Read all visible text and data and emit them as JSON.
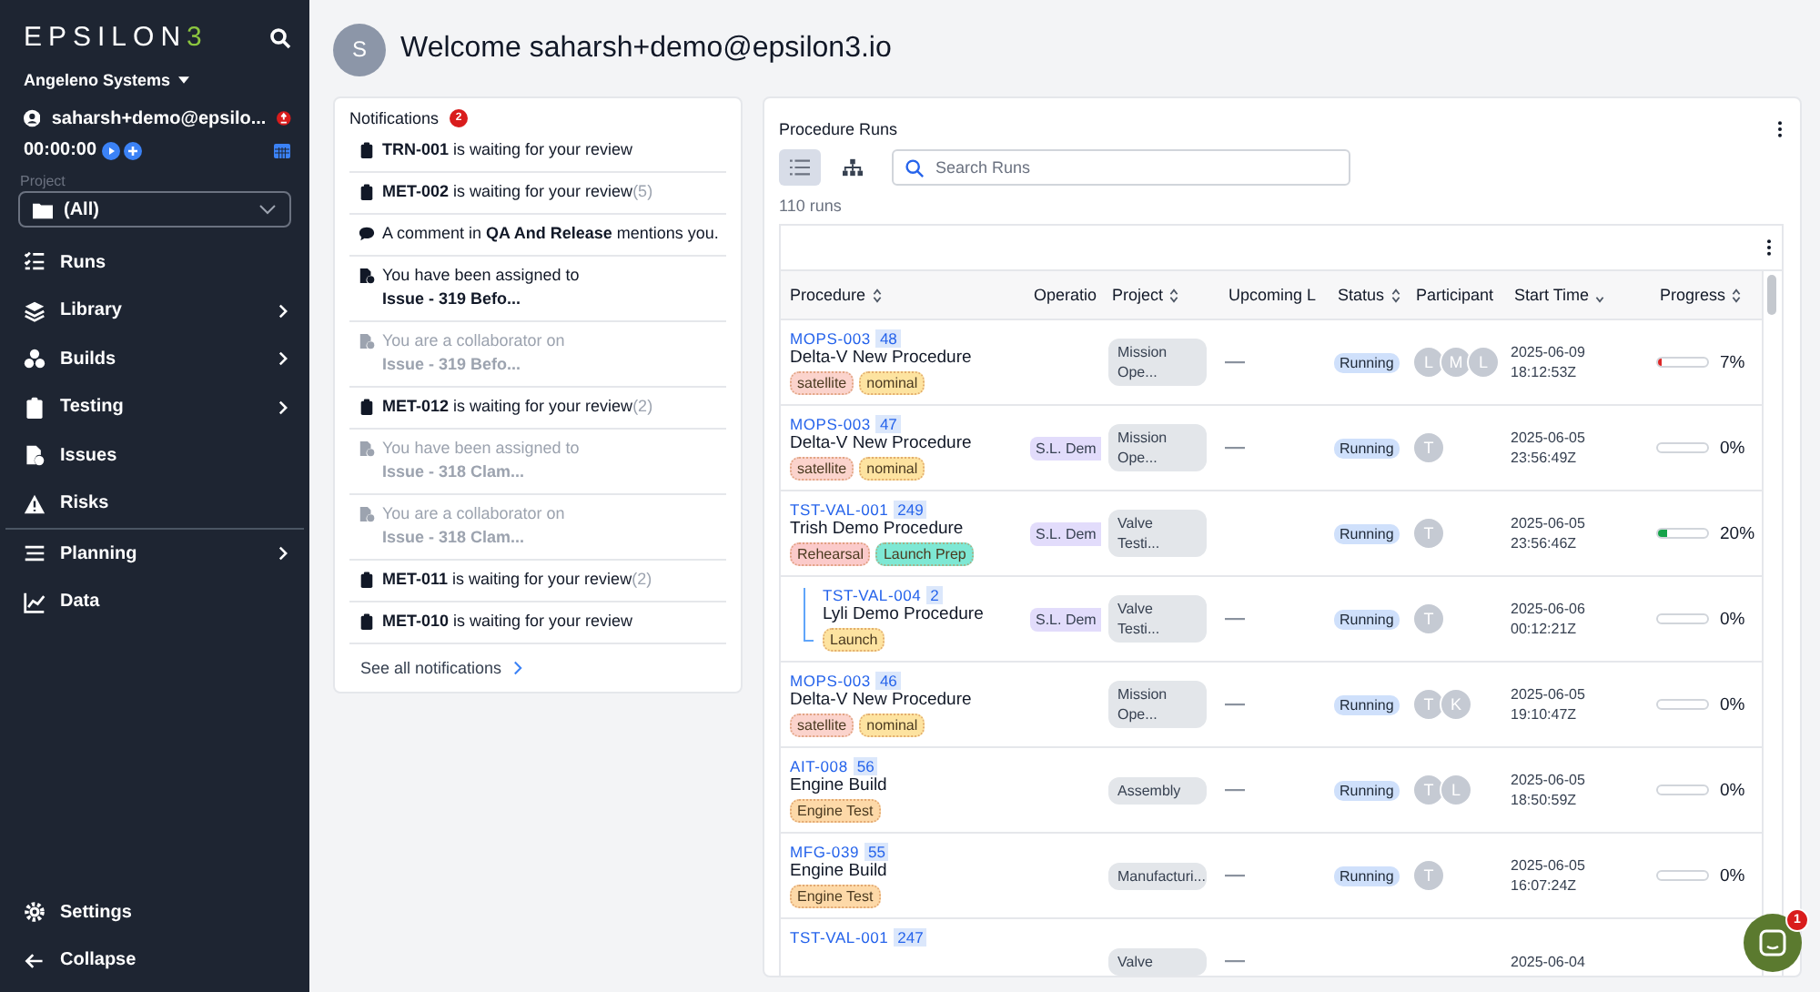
{
  "sidebar": {
    "logo": {
      "text": "EPSILON",
      "mark": "3"
    },
    "org": "Angeleno Systems",
    "user": "saharsh+demo@epsilo...",
    "timer": "00:00:00",
    "project": {
      "label": "Project",
      "value": "(All)"
    },
    "items": [
      {
        "label": "Runs",
        "expandable": false
      },
      {
        "label": "Library",
        "expandable": true
      },
      {
        "label": "Builds",
        "expandable": true
      },
      {
        "label": "Testing",
        "expandable": true
      },
      {
        "label": "Issues",
        "expandable": false
      },
      {
        "label": "Risks",
        "expandable": false
      }
    ],
    "items2": [
      {
        "label": "Planning",
        "expandable": true
      },
      {
        "label": "Data",
        "expandable": false
      }
    ],
    "footer": [
      "Settings",
      "Collapse"
    ]
  },
  "header": {
    "avatar": "S",
    "title": "Welcome saharsh+demo@epsilon3.io"
  },
  "notifications": {
    "title": "Notifications",
    "badge": "2",
    "link": "See all notifications",
    "items": [
      {
        "kind": "review",
        "read": false,
        "text": "**TRN-001** is waiting for your review"
      },
      {
        "kind": "review",
        "read": false,
        "text": "**MET-002** is waiting for your review",
        "count": "(5)"
      },
      {
        "kind": "comment",
        "read": false,
        "text": "A comment in **QA And Release** mentions you."
      },
      {
        "kind": "issue",
        "read": false,
        "text": "You have been assigned to",
        "subject": "Issue - 319 Befo..."
      },
      {
        "kind": "issue",
        "read": true,
        "text": "You are a collaborator on",
        "subject": "Issue - 319 Befo..."
      },
      {
        "kind": "review",
        "read": false,
        "text": "**MET-012** is waiting for your review",
        "count": "(2)"
      },
      {
        "kind": "issue",
        "read": true,
        "text": "You have been assigned to",
        "subject": "Issue - 318 Clam..."
      },
      {
        "kind": "issue",
        "read": true,
        "text": "You are a collaborator on",
        "subject": "Issue - 318 Clam..."
      },
      {
        "kind": "review",
        "read": false,
        "text": "**MET-011** is waiting for your review",
        "count": "(2)"
      },
      {
        "kind": "review",
        "read": false,
        "text": "**MET-010** is waiting for your review"
      }
    ]
  },
  "runs": {
    "title": "Procedure Runs",
    "views": [
      {
        "kind": "list",
        "selected": true
      },
      {
        "kind": "tree",
        "selected": false
      }
    ],
    "search": {
      "placeholder": "Search Runs"
    },
    "count": "110 runs",
    "columns": [
      "Procedure",
      "Operatio",
      "Project",
      "Upcoming L",
      "Status",
      "Participant",
      "Start Time",
      "Progress"
    ],
    "rows": [
      {
        "id": "MOPS-003",
        "run": "48",
        "name": "Delta-V New Procedure",
        "tags": [
          {
            "label": "satellite",
            "color": "#fbd3cc"
          },
          {
            "label": "nominal",
            "color": "#fde3a0"
          }
        ],
        "project": "Mission Ope...",
        "upcoming": "—",
        "status": "Running",
        "participants": [
          "L",
          "M",
          "L"
        ],
        "date": "2025-06-09",
        "time": "18:12:53Z",
        "progress": {
          "level": 0.07,
          "reading": "7%",
          "color": "#dc2626"
        }
      },
      {
        "id": "MOPS-003",
        "run": "47",
        "name": "Delta-V New Procedure",
        "tags": [
          {
            "label": "satellite",
            "color": "#fbd3cc"
          },
          {
            "label": "nominal",
            "color": "#fde3a0"
          }
        ],
        "operation": "S.L. Dem",
        "project": "Mission Ope...",
        "upcoming": "—",
        "status": "Running",
        "participants": [
          "T"
        ],
        "date": "2025-06-05",
        "time": "23:56:49Z",
        "progress": {
          "level": 0,
          "reading": "0%"
        }
      },
      {
        "id": "TST-VAL-001",
        "run": "249",
        "name": "Trish Demo Procedure",
        "tags": [
          {
            "label": "Rehearsal",
            "color": "#fbcaca"
          },
          {
            "label": "Launch Prep",
            "color": "#7ee8d4"
          }
        ],
        "operation": "S.L. Dem",
        "project": "Valve Testi...",
        "status": "Running",
        "participants": [
          "T"
        ],
        "date": "2025-06-05",
        "time": "23:56:46Z",
        "progress": {
          "level": 0.2,
          "reading": "20%",
          "color": "#16a34a"
        },
        "children": [
          {
            "id": "TST-VAL-004",
            "run": "2",
            "name": "Lyli Demo Procedure",
            "tags": [
              {
                "label": "Launch",
                "color": "#fde3a0"
              }
            ],
            "operation": "S.L. Dem",
            "project": "Valve Testi...",
            "upcoming": "—",
            "status": "Running",
            "participants": [
              "T"
            ],
            "date": "2025-06-06",
            "time": "00:12:21Z",
            "progress": {
              "level": 0,
              "reading": "0%"
            }
          }
        ]
      },
      {
        "id": "MOPS-003",
        "run": "46",
        "name": "Delta-V New Procedure",
        "tags": [
          {
            "label": "satellite",
            "color": "#fbd3cc"
          },
          {
            "label": "nominal",
            "color": "#fde3a0"
          }
        ],
        "project": "Mission Ope...",
        "upcoming": "—",
        "status": "Running",
        "participants": [
          "T",
          "K"
        ],
        "date": "2025-06-05",
        "time": "19:10:47Z",
        "progress": {
          "level": 0,
          "reading": "0%"
        }
      },
      {
        "id": "AIT-008",
        "run": "56",
        "name": "Engine Build",
        "tags": [
          {
            "label": "Engine Test",
            "color": "#fdd9a8"
          }
        ],
        "project": "Assembly",
        "upcoming": "—",
        "status": "Running",
        "participants": [
          "T",
          "L"
        ],
        "date": "2025-06-05",
        "time": "18:50:59Z",
        "progress": {
          "level": 0,
          "reading": "0%"
        }
      },
      {
        "id": "MFG-039",
        "run": "55",
        "name": "Engine Build",
        "tags": [
          {
            "label": "Engine Test",
            "color": "#fdd9a8"
          }
        ],
        "project": "Manufacturi...",
        "upcoming": "—",
        "status": "Running",
        "participants": [
          "T"
        ],
        "date": "2025-06-05",
        "time": "16:07:24Z",
        "progress": {
          "level": 0,
          "reading": "0%"
        }
      },
      {
        "id": "TST-VAL-001",
        "run": "247",
        "project": "Valve",
        "upcoming": "—",
        "date": "2025-06-04"
      }
    ]
  },
  "chat": {
    "badge": "1"
  }
}
